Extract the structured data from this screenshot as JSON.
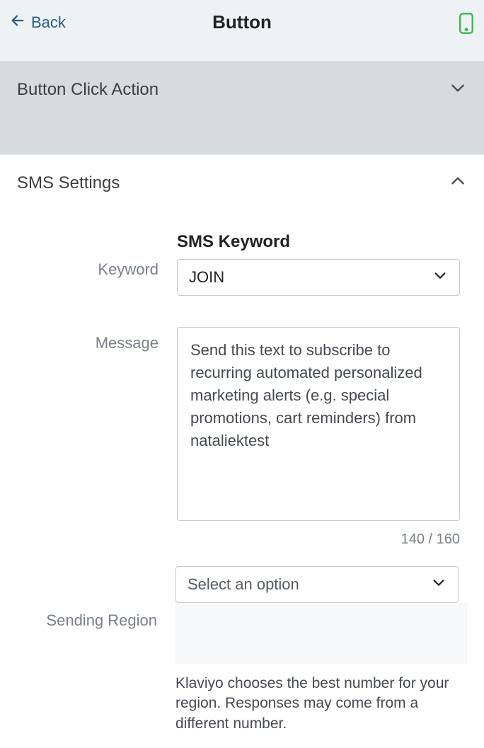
{
  "header": {
    "back_label": "Back",
    "title": "Button"
  },
  "sections": {
    "click_action": {
      "title": "Button Click Action"
    },
    "sms_settings": {
      "title": "SMS Settings"
    }
  },
  "form": {
    "keyword": {
      "heading": "SMS Keyword",
      "label": "Keyword",
      "value": "JOIN"
    },
    "message": {
      "label": "Message",
      "value": "Send this text to subscribe to recurring automated personalized marketing alerts (e.g. special promotions, cart reminders) from nataliektest",
      "char_count": "140 / 160"
    },
    "region": {
      "label": "Sending Region",
      "placeholder": "Select an option",
      "help": "Klaviyo chooses the best number for your region. Responses may come from a different number."
    }
  }
}
